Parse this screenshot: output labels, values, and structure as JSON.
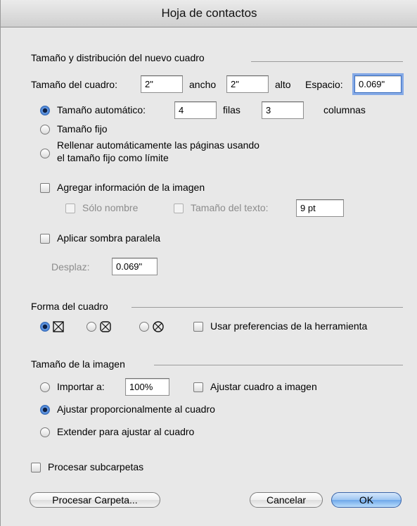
{
  "window": {
    "title": "Hoja de contactos"
  },
  "layout_section": {
    "title": "Tamaño y distribución del nuevo cuadro",
    "size_label": "Tamaño del cuadro:",
    "width_value": "2\"",
    "width_label": "ancho",
    "height_value": "2\"",
    "height_label": "alto",
    "spacing_label": "Espacio:",
    "spacing_value": "0.069\"",
    "auto_size_label": "Tamaño automático:",
    "rows_value": "4",
    "rows_label": "filas",
    "cols_value": "3",
    "cols_label": "columnas",
    "fixed_size_label": "Tamaño fijo",
    "autofill_label_1": "Rellenar automáticamente las páginas usando",
    "autofill_label_2": "el tamaño fijo como límite",
    "add_info_label": "Agregar información de la imagen",
    "name_only_label": "Sólo nombre",
    "text_size_label": "Tamaño del texto:",
    "text_size_value": "9 pt",
    "drop_shadow_label": "Aplicar sombra paralela",
    "offset_label": "Desplaz:",
    "offset_value": "0.069\""
  },
  "shape_section": {
    "title": "Forma del cuadro",
    "use_tool_prefs_label": "Usar preferencias de la herramienta",
    "shapes": [
      {
        "icon": "rectangle-box-icon",
        "selected": true
      },
      {
        "icon": "rounded-box-icon",
        "selected": false
      },
      {
        "icon": "oval-box-icon",
        "selected": false
      }
    ]
  },
  "image_section": {
    "title": "Tamaño de la imagen",
    "import_label": "Importar a:",
    "import_value": "100%",
    "fit_box_label": "Ajustar cuadro a imagen",
    "fit_prop_label": "Ajustar proporcionalmente al cuadro",
    "stretch_label": "Extender para ajustar al cuadro"
  },
  "subfolders_label": "Procesar subcarpetas",
  "buttons": {
    "process_folder": "Procesar Carpeta...",
    "cancel": "Cancelar",
    "ok": "OK"
  },
  "colors": {
    "dialog_bg": "#e8e8e8",
    "default_button": "#6fa8ea",
    "focus_ring": "#84a9e6",
    "radio_selected": "#2c66c3"
  },
  "state": {
    "size_mode": "auto",
    "image_size_mode": "fit_proportional",
    "add_info_checked": false,
    "drop_shadow_checked": false,
    "use_tool_prefs_checked": false,
    "fit_box_checked": false,
    "subfolders_checked": false
  }
}
